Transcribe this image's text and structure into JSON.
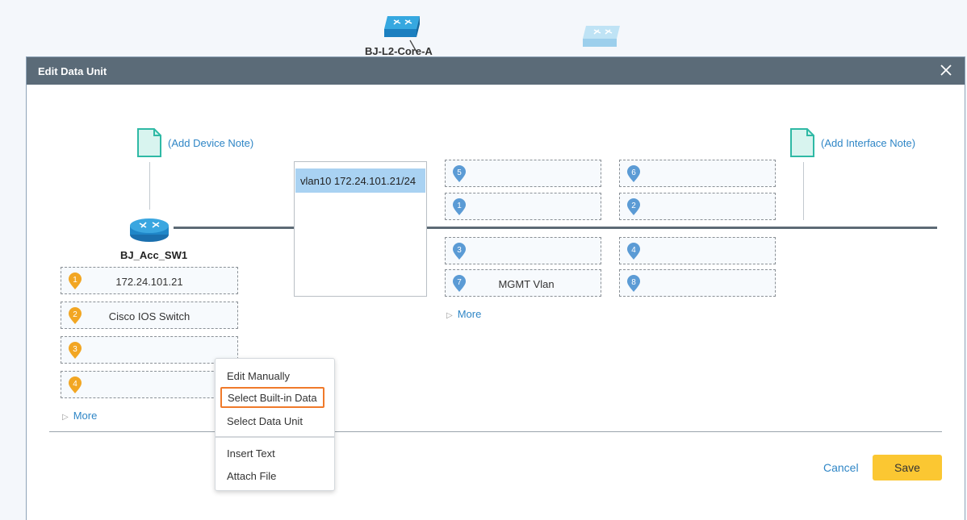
{
  "background": {
    "core_switch_label": "BJ-L2-Core-A"
  },
  "dialog": {
    "title": "Edit Data Unit",
    "device_note_link": "(Add Device Note)",
    "interface_note_link": "(Add Interface Note)",
    "device_name": "BJ_Acc_SW1",
    "device_fields": [
      {
        "num": "1",
        "value": "172.24.101.21"
      },
      {
        "num": "2",
        "value": "Cisco IOS Switch"
      },
      {
        "num": "3",
        "value": ""
      },
      {
        "num": "4",
        "value": ""
      }
    ],
    "device_more": "More",
    "interface_list": [
      "vlan10 172.24.101.21/24"
    ],
    "interface_fields": [
      {
        "num": "5",
        "value": ""
      },
      {
        "num": "6",
        "value": ""
      },
      {
        "num": "1",
        "value": ""
      },
      {
        "num": "2",
        "value": ""
      },
      {
        "num": "3",
        "value": ""
      },
      {
        "num": "4",
        "value": ""
      },
      {
        "num": "7",
        "value": "MGMT Vlan"
      },
      {
        "num": "8",
        "value": ""
      }
    ],
    "interface_more": "More",
    "cancel_label": "Cancel",
    "save_label": "Save"
  },
  "context_menu": {
    "items": [
      "Edit Manually",
      "Select Built-in Data",
      "Select Data Unit",
      "Insert Text",
      "Attach File"
    ],
    "highlighted_item": "Select Built-in Data"
  },
  "colors": {
    "titlebar": "#5b6b78",
    "device_pin": "#f2a623",
    "interface_pin": "#5b9bd5",
    "link": "#2f86c6",
    "save_button": "#fbc732",
    "highlight_border": "#f07a2a",
    "selected_row": "#a9d2f2"
  },
  "icons": {
    "device": "router-icon",
    "note": "document-icon",
    "close": "close-icon",
    "expand": "triangle-right-icon"
  }
}
